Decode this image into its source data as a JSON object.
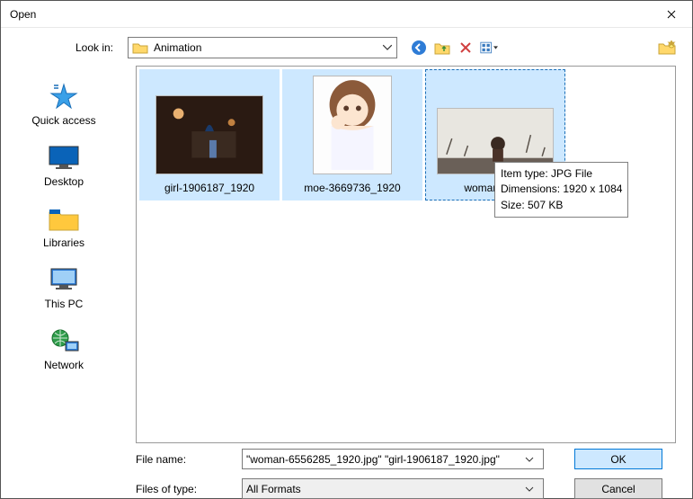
{
  "window": {
    "title": "Open"
  },
  "lookin": {
    "label": "Look in:",
    "folder": "Animation"
  },
  "places": {
    "quick": "Quick access",
    "desktop": "Desktop",
    "libraries": "Libraries",
    "thispc": "This PC",
    "network": "Network"
  },
  "files": {
    "f0": "girl-1906187_1920",
    "f1": "moe-3669736_1920",
    "f2": "woman-6556"
  },
  "tooltip": {
    "line1": "Item type: JPG File",
    "line2": "Dimensions: 1920 x 1084",
    "line3": "Size: 507 KB"
  },
  "bottom": {
    "filename_label": "File name:",
    "filename_value": "\"woman-6556285_1920.jpg\" \"girl-1906187_1920.jpg\"",
    "filetype_label": "Files of type:",
    "filetype_value": "All Formats",
    "ok": "OK",
    "cancel": "Cancel"
  }
}
